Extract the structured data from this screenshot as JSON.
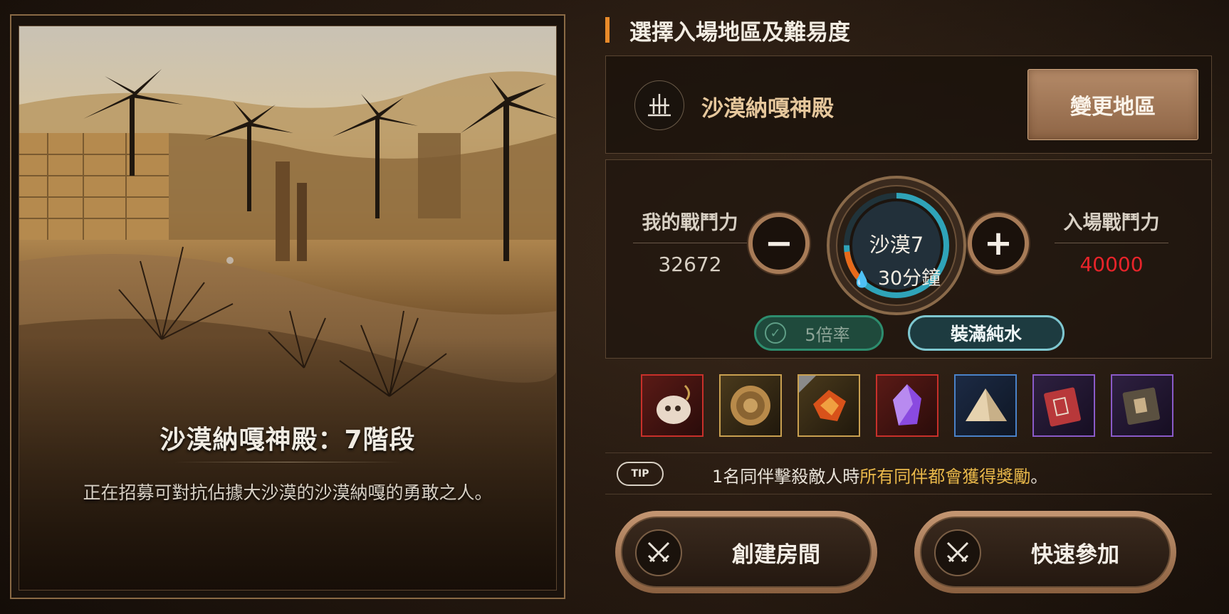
{
  "scene": {
    "title": "沙漠納嘎神殿：7階段",
    "description": "正在招募可對抗佔據大沙漠的沙漠納嘎的勇敢之人。"
  },
  "section": {
    "title": "選擇入場地區及難易度"
  },
  "region": {
    "icon": "temple-sword-icon",
    "name": "沙漠納嘎神殿",
    "change_label": "變更地區"
  },
  "difficulty": {
    "my_power_label": "我的戰鬥力",
    "my_power_value": "32672",
    "required_power_label": "入場戰鬥力",
    "required_power_value": "40000",
    "stage_name": "沙漠7",
    "time_label": "30分鐘",
    "decrease_symbol": "−",
    "increase_symbol": "+",
    "rate_tag": "5倍率",
    "water_tag": "裝滿純水",
    "colors": {
      "required": "#e8242a",
      "dial_progress": "#2fa3b8",
      "dial_warn": "#e86a1a"
    }
  },
  "rewards": [
    {
      "icon": "skull-pendant-icon",
      "rarity": "red"
    },
    {
      "icon": "gold-coin-icon",
      "rarity": "gold"
    },
    {
      "icon": "fire-crystal-icon",
      "rarity": "gold"
    },
    {
      "icon": "purple-crystal-icon",
      "rarity": "red"
    },
    {
      "icon": "sand-pyramid-icon",
      "rarity": "blue"
    },
    {
      "icon": "red-book-icon",
      "rarity": "purple"
    },
    {
      "icon": "dark-book-icon",
      "rarity": "purple"
    }
  ],
  "tip": {
    "badge": "TIP",
    "text_before": "1名同伴擊殺敵人時",
    "text_highlight": "所有同伴都會獲得獎勵",
    "text_after": "。"
  },
  "actions": {
    "create_label": "創建房間",
    "quick_label": "快速參加"
  }
}
